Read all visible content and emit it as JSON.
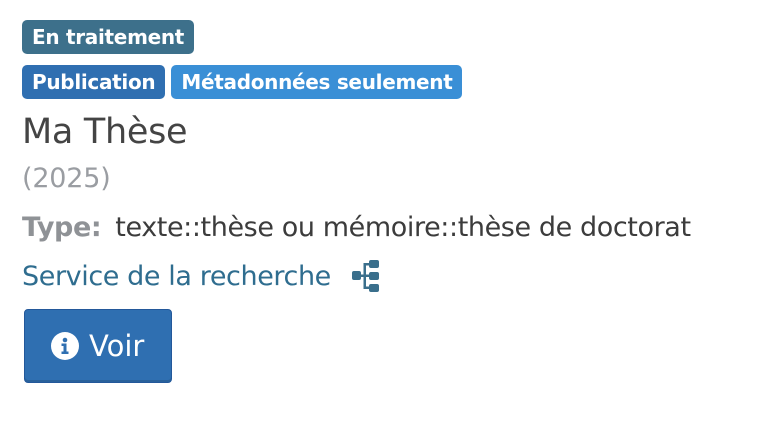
{
  "badges": {
    "status": "En traitement",
    "type": "Publication",
    "metadata": "Métadonnées seulement"
  },
  "record": {
    "title": "Ma Thèse",
    "year": "(2025)",
    "type_label": "Type:",
    "type_value": "texte::thèse ou mémoire::thèse de doctorat",
    "organization": "Service de la recherche"
  },
  "actions": {
    "view_label": "Voir"
  },
  "icons": {
    "organization_tree": "sitemap-icon",
    "view": "info-circle-icon"
  },
  "colors": {
    "status_badge": "#3d708b",
    "type_badge": "#2f6fb1",
    "metadata_badge": "#3a8fd6",
    "link": "#2f6d8f",
    "button": "#2f6fb1"
  }
}
